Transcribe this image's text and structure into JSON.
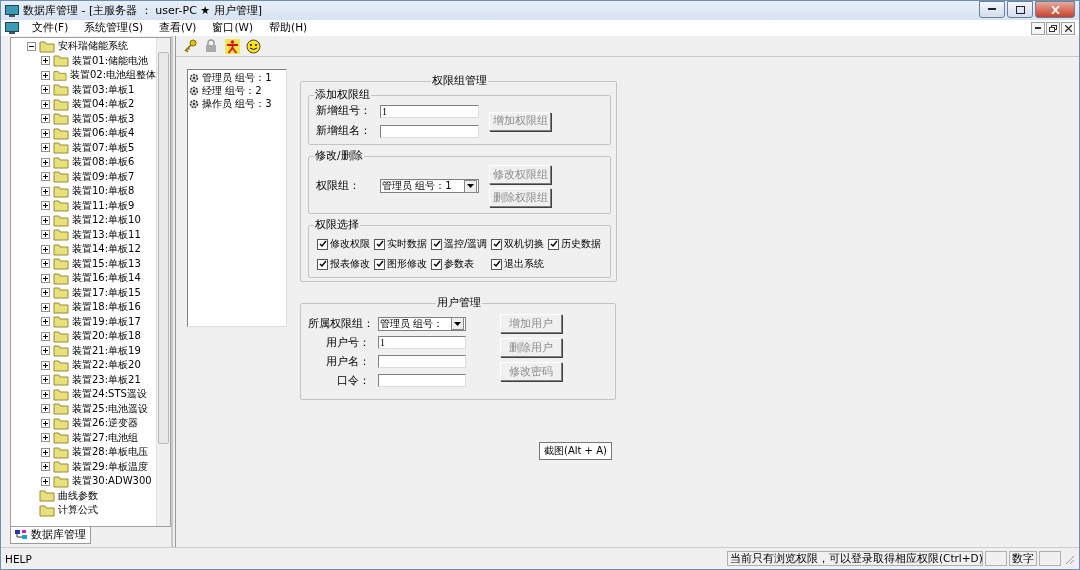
{
  "window": {
    "title": "数据库管理 - [主服务器 ： user-PC ★ 用户管理]"
  },
  "menu": [
    "文件(F)",
    "系统管理(S)",
    "查看(V)",
    "窗口(W)",
    "帮助(H)"
  ],
  "tree": {
    "label": "安科瑞储能系统",
    "expanded": true,
    "children": [
      {
        "label": "装置01:储能电池",
        "expanded": false
      },
      {
        "label": "装置02:电池组整体",
        "expanded": false
      },
      {
        "label": "装置03:单板1",
        "expanded": false
      },
      {
        "label": "装置04:单板2",
        "expanded": false
      },
      {
        "label": "装置05:单板3",
        "expanded": false
      },
      {
        "label": "装置06:单板4",
        "expanded": false
      },
      {
        "label": "装置07:单板5",
        "expanded": false
      },
      {
        "label": "装置08:单板6",
        "expanded": false
      },
      {
        "label": "装置09:单板7",
        "expanded": false
      },
      {
        "label": "装置10:单板8",
        "expanded": false
      },
      {
        "label": "装置11:单板9",
        "expanded": false
      },
      {
        "label": "装置12:单板10",
        "expanded": false
      },
      {
        "label": "装置13:单板11",
        "expanded": false
      },
      {
        "label": "装置14:单板12",
        "expanded": false
      },
      {
        "label": "装置15:单板13",
        "expanded": false
      },
      {
        "label": "装置16:单板14",
        "expanded": false
      },
      {
        "label": "装置17:单板15",
        "expanded": false
      },
      {
        "label": "装置18:单板16",
        "expanded": false
      },
      {
        "label": "装置19:单板17",
        "expanded": false
      },
      {
        "label": "装置20:单板18",
        "expanded": false
      },
      {
        "label": "装置21:单板19",
        "expanded": false
      },
      {
        "label": "装置22:单板20",
        "expanded": false
      },
      {
        "label": "装置23:单板21",
        "expanded": false
      },
      {
        "label": "装置24:STS遥设",
        "expanded": false
      },
      {
        "label": "装置25:电池遥设",
        "expanded": false
      },
      {
        "label": "装置26:逆变器",
        "expanded": false
      },
      {
        "label": "装置27:电池组",
        "expanded": false
      },
      {
        "label": "装置28:单板电压",
        "expanded": false
      },
      {
        "label": "装置29:单板温度",
        "expanded": false
      },
      {
        "label": "装置30:ADW300",
        "expanded": false
      }
    ],
    "siblings": [
      {
        "label": "曲线参数",
        "kind": "leaf"
      },
      {
        "label": "计算公式",
        "kind": "leaf"
      }
    ]
  },
  "left_tab": {
    "label": "数据库管理",
    "selected": true
  },
  "group_list": [
    "管理员 组号：1",
    "经理 组号：2",
    "操作员 组号：3"
  ],
  "group_management": {
    "title": "权限组管理",
    "add": {
      "title": "添加权限组",
      "fields": [
        {
          "label": "新增组号：",
          "value": "1"
        },
        {
          "label": "新增组名："
        }
      ],
      "button": {
        "label": "增加权限组",
        "disabled": true
      }
    },
    "edit": {
      "title": "修改/删除",
      "label": "权限组：",
      "value": "管理员 组号：1",
      "buttons": [
        {
          "label": "修改权限组",
          "disabled": true
        },
        {
          "label": "删除权限组",
          "disabled": true
        }
      ]
    },
    "permissions": {
      "title": "权限选择",
      "items": [
        {
          "label": "修改权限",
          "checked": true
        },
        {
          "label": "实时数据",
          "checked": true
        },
        {
          "label": "遥控/遥调",
          "checked": true
        },
        {
          "label": "双机切换",
          "checked": true
        },
        {
          "label": "历史数据",
          "checked": true
        },
        {
          "label": "报表修改",
          "checked": true
        },
        {
          "label": "图形修改",
          "checked": true
        },
        {
          "label": "参数表",
          "checked": true
        },
        {
          "label": "退出系统",
          "checked": true
        }
      ]
    }
  },
  "user_management": {
    "title": "用户管理",
    "fields": [
      {
        "kind": "combo",
        "label": "所属权限组：",
        "value": "管理员 组号："
      },
      {
        "kind": "text",
        "label": "用户号：",
        "value": "1"
      },
      {
        "kind": "text",
        "label": "用户名："
      },
      {
        "kind": "text",
        "label": "口令："
      }
    ],
    "buttons": [
      {
        "label": "增加用户",
        "disabled": true
      },
      {
        "label": "删除用户",
        "disabled": true
      },
      {
        "label": "修改密码",
        "disabled": true
      }
    ]
  },
  "tooltip": "截图(Alt + A)",
  "status_bar": {
    "left": "HELP",
    "message": "当前只有浏览权限，可以登录取得相应权限(Ctrl+D)",
    "indicator": "数字"
  }
}
